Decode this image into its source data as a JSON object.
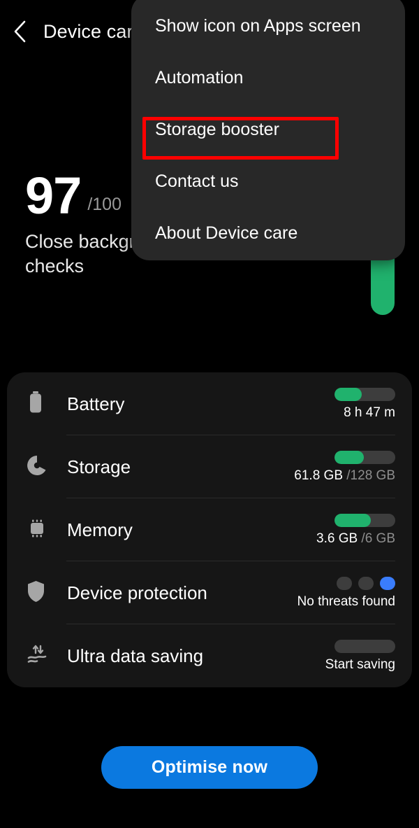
{
  "header": {
    "back_icon": "chevron-left-icon",
    "title": "Device care"
  },
  "hero": {
    "score": "97",
    "score_total": "/100",
    "subtitle": "Close background apps and run checks",
    "ring_color": "#20b26d"
  },
  "status_card": {
    "rows": [
      {
        "icon": "battery-icon",
        "label": "Battery",
        "value": "8 h 47 m",
        "value_muted": "",
        "indicator": "bar",
        "fill_percent": 45
      },
      {
        "icon": "storage-pie-icon",
        "label": "Storage",
        "value": "61.8 GB ",
        "value_muted": "/128 GB",
        "indicator": "bar",
        "fill_percent": 48
      },
      {
        "icon": "memory-chip-icon",
        "label": "Memory",
        "value": "3.6 GB ",
        "value_muted": "/6 GB",
        "indicator": "bar",
        "fill_percent": 60
      },
      {
        "icon": "shield-icon",
        "label": "Device protection",
        "value": "No threats found",
        "value_muted": "",
        "indicator": "dots",
        "dots_total": 3,
        "dots_active_index": 2
      },
      {
        "icon": "data-saving-icon",
        "label": "Ultra data saving",
        "value": "Start saving",
        "value_muted": "",
        "indicator": "bar",
        "fill_percent": 0
      }
    ]
  },
  "actions": {
    "optimise_label": "Optimise now",
    "optimise_color": "#0b79e0"
  },
  "overflow_menu": {
    "items": [
      {
        "label": "Show icon on Apps screen",
        "highlighted": false
      },
      {
        "label": "Automation",
        "highlighted": false
      },
      {
        "label": "Storage booster",
        "highlighted": true
      },
      {
        "label": "Contact us",
        "highlighted": false
      },
      {
        "label": "About Device care",
        "highlighted": false
      }
    ],
    "highlight_color": "#ff0000"
  }
}
